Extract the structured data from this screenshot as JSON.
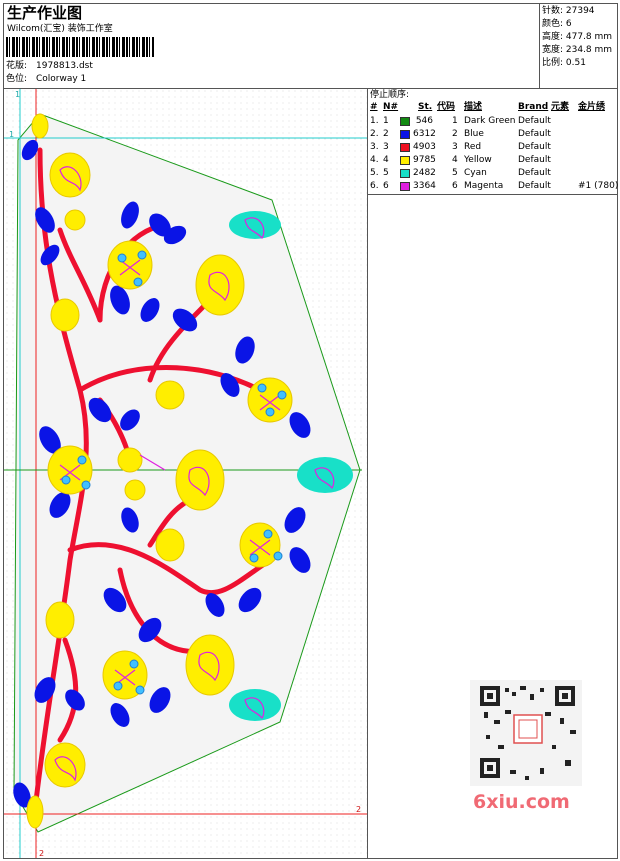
{
  "header": {
    "title": "生产作业图",
    "studio": "Wilcom(汇宝) 装饰工作室",
    "design_label": "花版:",
    "design_value": "1978813.dst",
    "colorway_label": "色位:",
    "colorway_value": "Colorway 1"
  },
  "stats": {
    "stitches": "针数: 27394",
    "colors": "颜色: 6",
    "height": "高度: 477.8 mm",
    "width": "宽度: 234.8 mm",
    "scale": "比例: 0.51"
  },
  "sequence": {
    "title": "停止顺序:",
    "headers": [
      "#",
      "N#",
      "St.",
      "代码",
      "描述",
      "Brand",
      "元素",
      "金片绣"
    ],
    "rows": [
      {
        "idx": "1.",
        "n": "1",
        "st": "546",
        "code": "1",
        "desc": "Dark Green",
        "brand": "Default",
        "elem": "",
        "color": "#128a12"
      },
      {
        "idx": "2.",
        "n": "2",
        "st": "6312",
        "code": "2",
        "desc": "Blue",
        "brand": "Default",
        "elem": "",
        "color": "#0a14e6"
      },
      {
        "idx": "3.",
        "n": "3",
        "st": "4903",
        "code": "3",
        "desc": "Red",
        "brand": "Default",
        "elem": "",
        "color": "#ee1020"
      },
      {
        "idx": "4.",
        "n": "4",
        "st": "9785",
        "code": "4",
        "desc": "Yellow",
        "brand": "Default",
        "elem": "",
        "color": "#ffee00"
      },
      {
        "idx": "5.",
        "n": "5",
        "st": "2482",
        "code": "5",
        "desc": "Cyan",
        "brand": "Default",
        "elem": "",
        "color": "#18e0c8"
      },
      {
        "idx": "6.",
        "n": "6",
        "st": "3364",
        "code": "6",
        "desc": "Magenta",
        "brand": "Default",
        "elem": "#1 (780)",
        "color": "#e020e0"
      }
    ]
  },
  "guides": {
    "v1": "1",
    "h1": "1",
    "h2": "2",
    "v2": "2"
  },
  "watermark": {
    "site": "6xiu.com"
  }
}
